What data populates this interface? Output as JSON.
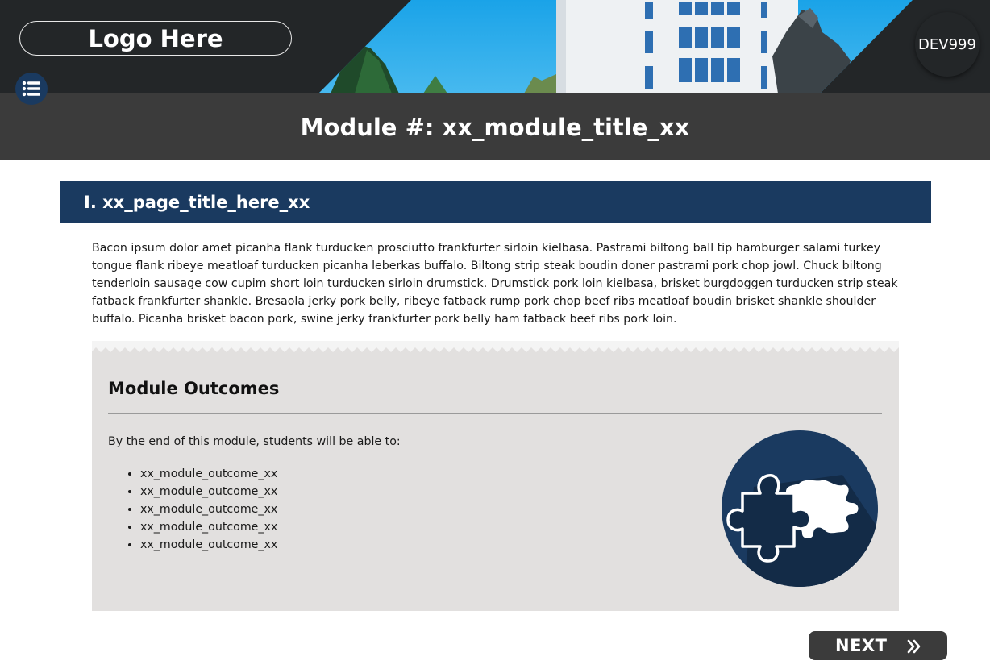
{
  "header": {
    "logo_text": "Logo Here",
    "course_code": "DEV999",
    "menu_icon": "list-icon"
  },
  "module_title": "Module #: xx_module_title_xx",
  "page": {
    "heading": "I. xx_page_title_here_xx",
    "intro_text": "Bacon ipsum dolor amet picanha flank turducken prosciutto frankfurter sirloin kielbasa. Pastrami biltong ball tip hamburger salami turkey tongue flank ribeye meatloaf turducken picanha leberkas buffalo. Biltong strip steak boudin doner pastrami pork chop jowl. Chuck biltong tenderloin sausage cow cupim short loin turducken sirloin drumstick. Drumstick pork loin kielbasa, brisket burgdoggen turducken strip steak fatback frankfurter shankle. Bresaola jerky pork belly, ribeye fatback rump pork chop beef ribs meatloaf boudin brisket shankle shoulder buffalo. Picanha brisket bacon pork, swine jerky frankfurter pork belly ham fatback beef ribs pork loin."
  },
  "outcomes": {
    "heading": "Module Outcomes",
    "lead": "By the end of this module, students will be able to:",
    "items": [
      "xx_module_outcome_xx",
      "xx_module_outcome_xx",
      "xx_module_outcome_xx",
      "xx_module_outcome_xx",
      "xx_module_outcome_xx"
    ],
    "icon": "puzzle-piece-icon"
  },
  "navigation": {
    "next_label": "NEXT",
    "next_icon": "double-chevron-right-icon"
  },
  "colors": {
    "navy": "#1a3a60",
    "dark_bar": "#3b3b3b",
    "header_bg": "#232628",
    "outcomes_bg": "#e2e0df"
  }
}
